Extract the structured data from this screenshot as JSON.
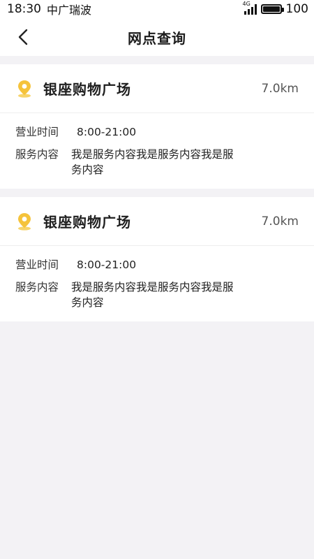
{
  "status_bar": {
    "time": "18:30",
    "carrier": "中广瑞波",
    "network": "4G",
    "battery": "100"
  },
  "header": {
    "title": "网点查询"
  },
  "stores": [
    {
      "name": "银座购物广场",
      "distance": "7.0km",
      "hours_label": "营业时间",
      "hours": "8:00-21:00",
      "service_label": "服务内容",
      "service": "我是服务内容我是服务内容我是服务内容"
    },
    {
      "name": "银座购物广场",
      "distance": "7.0km",
      "hours_label": "营业时间",
      "hours": "8:00-21:00",
      "service_label": "服务内容",
      "service": "我是服务内容我是服务内容我是服务内容"
    }
  ],
  "colors": {
    "pin": "#f5c33b",
    "background": "#f3f2f5",
    "card": "#ffffff"
  }
}
